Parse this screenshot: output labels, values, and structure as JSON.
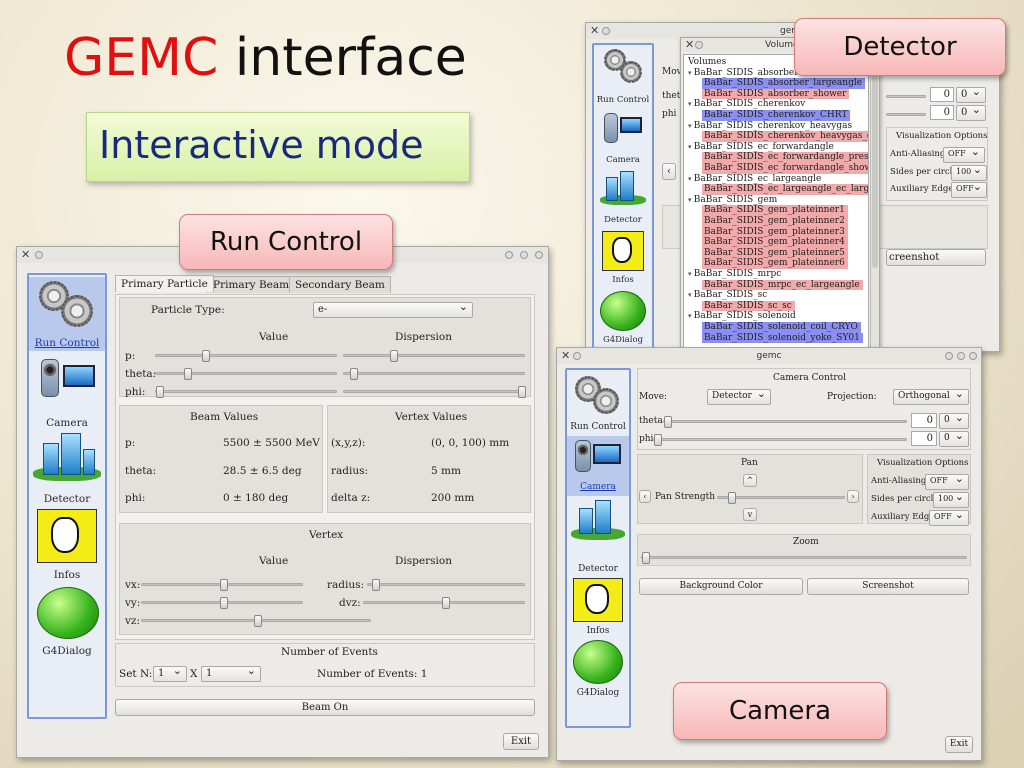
{
  "slide": {
    "title_red": "GEMC",
    "title_black": " interface",
    "subtitle": "Interactive mode",
    "callouts": {
      "run_control": "Run Control",
      "detector": "Detector",
      "camera": "Camera"
    },
    "colors": {
      "title_red": "#e01010",
      "subtitle_blue": "#1a2a78",
      "nav_border": "#7b99d8",
      "tree_red": "#f2a9a9",
      "tree_blue": "#8b8ff2"
    }
  },
  "nav": {
    "run_control": "Run Control",
    "camera": "Camera",
    "detector": "Detector",
    "infos": "Infos",
    "g4dialog": "G4Dialog"
  },
  "run_window": {
    "tabs": [
      "Primary Particle",
      "Primary Beam",
      "Secondary Beam"
    ],
    "particle_type_label": "Particle Type:",
    "particle_type_value": "e-",
    "value_header": "Value",
    "dispersion_header": "Dispersion",
    "slider_labels": [
      "p:",
      "theta:",
      "phi:"
    ],
    "beam_values": {
      "title": "Beam Values",
      "rows": [
        {
          "label": "p:",
          "value": "5500 ± 5500 MeV"
        },
        {
          "label": "theta:",
          "value": "28.5 ± 6.5 deg"
        },
        {
          "label": "phi:",
          "value": "0 ± 180 deg"
        }
      ]
    },
    "vertex_values": {
      "title": "Vertex Values",
      "rows": [
        {
          "label": "(x,y,z):",
          "value": "(0, 0, 100) mm"
        },
        {
          "label": "radius:",
          "value": "5 mm"
        },
        {
          "label": "delta z:",
          "value": "200 mm"
        }
      ]
    },
    "vertex": {
      "title": "Vertex",
      "value_header": "Value",
      "dispersion_header": "Dispersion",
      "labels": [
        "vx:",
        "vy:",
        "vz:"
      ],
      "disp_labels": [
        "radius:",
        "dvz:"
      ]
    },
    "events": {
      "title": "Number of Events",
      "set_n_label": "Set N:",
      "n_value": "1",
      "x_label": "X",
      "x_value": "1",
      "count_text": "Number of Events: 1"
    },
    "beam_on": "Beam On",
    "exit": "Exit"
  },
  "detector_window": {
    "title": "gemc",
    "tree_title": "Volumes Tree",
    "left_labels": [
      "Mov",
      "theta",
      "phi"
    ],
    "spin_values": [
      "0",
      "0"
    ],
    "combo_values": [
      "0",
      "0"
    ],
    "vis_title": "Visualization Options",
    "vis_rows": [
      {
        "label": "Anti-Aliasing",
        "value": "OFF"
      },
      {
        "label": "Sides per circle",
        "value": "100"
      },
      {
        "label": "Auxiliary Edges",
        "value": "OFF"
      }
    ],
    "screenshot": "creenshot",
    "tree_rows": [
      {
        "text": "Volumes",
        "kind": "plain",
        "indent": 0
      },
      {
        "text": "BaBar_SIDIS_absorber",
        "kind": "parent",
        "indent": 0
      },
      {
        "text": "BaBar_SIDIS_absorber_largeangle",
        "kind": "blue",
        "indent": 1
      },
      {
        "text": "BaBar_SIDIS_absorber_shower",
        "kind": "red",
        "indent": 1
      },
      {
        "text": "BaBar_SIDIS_cherenkov",
        "kind": "parent",
        "indent": 0
      },
      {
        "text": "BaBar_SIDIS_cherenkov_CHRT",
        "kind": "blue",
        "indent": 1
      },
      {
        "text": "BaBar_SIDIS_cherenkov_heavygas",
        "kind": "parent",
        "indent": 0
      },
      {
        "text": "BaBar_SIDIS_cherenkov_heavygas_chere...",
        "kind": "red",
        "indent": 1
      },
      {
        "text": "BaBar_SIDIS_ec_forwardangle",
        "kind": "parent",
        "indent": 0
      },
      {
        "text": "BaBar_SIDIS_ec_forwardangle_preshower",
        "kind": "red",
        "indent": 1
      },
      {
        "text": "BaBar_SIDIS_ec_forwardangle_shower",
        "kind": "red",
        "indent": 1
      },
      {
        "text": "BaBar_SIDIS_ec_largeangle",
        "kind": "parent",
        "indent": 0
      },
      {
        "text": "BaBar_SIDIS_ec_largeangle_ec_largeangle",
        "kind": "red",
        "indent": 1
      },
      {
        "text": "BaBar_SIDIS_gem",
        "kind": "parent",
        "indent": 0
      },
      {
        "text": "BaBar_SIDIS_gem_plateinner1",
        "kind": "red",
        "indent": 1
      },
      {
        "text": "BaBar_SIDIS_gem_plateinner2",
        "kind": "red",
        "indent": 1
      },
      {
        "text": "BaBar_SIDIS_gem_plateinner3",
        "kind": "red",
        "indent": 1
      },
      {
        "text": "BaBar_SIDIS_gem_plateinner4",
        "kind": "red",
        "indent": 1
      },
      {
        "text": "BaBar_SIDIS_gem_plateinner5",
        "kind": "red",
        "indent": 1
      },
      {
        "text": "BaBar_SIDIS_gem_plateinner6",
        "kind": "red",
        "indent": 1
      },
      {
        "text": "BaBar_SIDIS_mrpc",
        "kind": "parent",
        "indent": 0
      },
      {
        "text": "BaBar_SIDIS_mrpc_ec_largeangle",
        "kind": "red",
        "indent": 1
      },
      {
        "text": "BaBar_SIDIS_sc",
        "kind": "parent",
        "indent": 0
      },
      {
        "text": "BaBar_SIDIS_sc_sc",
        "kind": "red",
        "indent": 1
      },
      {
        "text": "BaBar_SIDIS_solenoid",
        "kind": "parent",
        "indent": 0
      },
      {
        "text": "BaBar_SIDIS_solenoid_coil_CRYO",
        "kind": "blue",
        "indent": 1
      },
      {
        "text": "BaBar_SIDIS_solenoid_yoke_SY01",
        "kind": "blue",
        "indent": 1
      }
    ]
  },
  "camera_window": {
    "title": "gemc",
    "camera_control": "Camera Control",
    "move_label": "Move:",
    "move_value": "Detector",
    "projection_label": "Projection:",
    "projection_value": "Orthogonal",
    "theta_label": "theta",
    "phi_label": "phi",
    "spin_values": [
      "0",
      "0"
    ],
    "combo_values": [
      "0",
      "0"
    ],
    "pan_title": "Pan",
    "pan_strength": "Pan Strength",
    "vis_title": "Visualization Options",
    "vis_rows": [
      {
        "label": "Anti-Aliasing",
        "value": "OFF"
      },
      {
        "label": "Sides per circle",
        "value": "100"
      },
      {
        "label": "Auxiliary Edges",
        "value": "OFF"
      }
    ],
    "zoom_title": "Zoom",
    "background_color": "Background Color",
    "screenshot": "Screenshot",
    "exit": "Exit"
  }
}
